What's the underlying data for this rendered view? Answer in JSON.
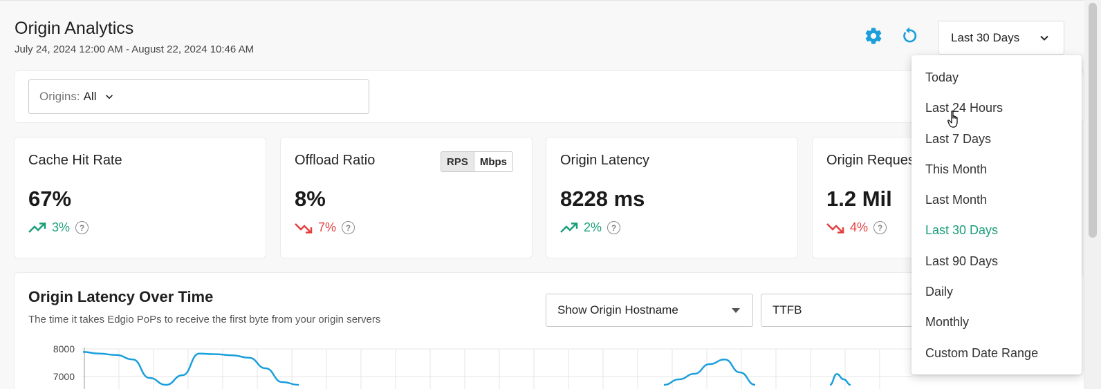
{
  "header": {
    "title": "Origin Analytics",
    "date_range": "July 24, 2024 12:00 AM - August 22, 2024 10:46 AM",
    "settings_icon": "gear-icon",
    "refresh_icon": "refresh-icon",
    "range_selected": "Last 30 Days"
  },
  "filters": {
    "origins_label": "Origins:",
    "origins_value": "All"
  },
  "metrics": [
    {
      "title": "Cache Hit Rate",
      "value": "67%",
      "change": "3%",
      "direction": "up"
    },
    {
      "title": "Offload Ratio",
      "value": "8%",
      "change": "7%",
      "direction": "down",
      "toggle": [
        "RPS",
        "Mbps"
      ]
    },
    {
      "title": "Origin Latency",
      "value": "8228 ms",
      "change": "2%",
      "direction": "up"
    },
    {
      "title": "Origin Reques",
      "value": "1.2 Mil",
      "change": "4%",
      "direction": "down"
    }
  ],
  "chart_section": {
    "title": "Origin Latency Over Time",
    "subtitle": "The time it takes Edgio PoPs to receive the first byte from your origin servers",
    "hostname_select": "Show Origin Hostname",
    "metric_select": "TTFB"
  },
  "chart_data": {
    "type": "line",
    "y_ticks": [
      "8000",
      "7000"
    ],
    "ylim": [
      6700,
      8100
    ],
    "series": [
      {
        "values": [
          7890,
          7830,
          7780,
          7620,
          6950,
          6700,
          7050,
          7830,
          7810,
          7770,
          7680,
          7300,
          6800,
          6700
        ]
      }
    ],
    "series2": [
      {
        "values": [
          6700,
          6900,
          7100,
          7450,
          7620,
          7150,
          6700
        ]
      },
      {
        "values": [
          6700,
          7090,
          6900,
          6700
        ]
      }
    ],
    "grid": true,
    "accent": "#1a9fdb"
  },
  "dropdown": {
    "options": [
      "Today",
      "Last 24 Hours",
      "Last 7 Days",
      "This Month",
      "Last Month",
      "Last 30 Days",
      "Last 90 Days",
      "Daily",
      "Monthly",
      "Custom Date Range"
    ],
    "selected": "Last 30 Days"
  },
  "colors": {
    "accent": "#1a9fdb",
    "positive": "#1a9e7a",
    "negative": "#e53e3e"
  }
}
